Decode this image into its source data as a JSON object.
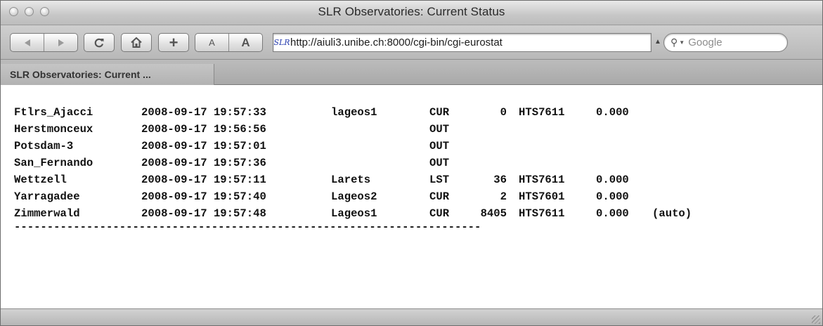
{
  "window": {
    "title": "SLR Observatories: Current Status"
  },
  "toolbar": {
    "back_icon": "back-arrow-icon",
    "forward_icon": "forward-arrow-icon",
    "reload_icon": "reload-icon",
    "home_icon": "home-icon",
    "add_bookmark_label": "+",
    "text_smaller_label": "A",
    "text_bigger_label": "A",
    "address_site_icon_text": "SLR",
    "address_url": "http://aiuli3.unibe.ch:8000/cgi-bin/cgi-eurostat",
    "search_placeholder": "Google"
  },
  "tabs": [
    {
      "label": "SLR Observatories: Current ..."
    }
  ],
  "status_rows": [
    {
      "station": "Ftlrs_Ajacci",
      "date": "2008-09-17",
      "time": "19:57:33",
      "satellite": "lageos1",
      "state": "CUR",
      "count": "0",
      "program": "HTS7611",
      "value": "0.000",
      "mode": ""
    },
    {
      "station": "Herstmonceux",
      "date": "2008-09-17",
      "time": "19:56:56",
      "satellite": "",
      "state": "OUT",
      "count": "",
      "program": "",
      "value": "",
      "mode": ""
    },
    {
      "station": "Potsdam-3",
      "date": "2008-09-17",
      "time": "19:57:01",
      "satellite": "",
      "state": "OUT",
      "count": "",
      "program": "",
      "value": "",
      "mode": ""
    },
    {
      "station": "San_Fernando",
      "date": "2008-09-17",
      "time": "19:57:36",
      "satellite": "",
      "state": "OUT",
      "count": "",
      "program": "",
      "value": "",
      "mode": ""
    },
    {
      "station": "Wettzell",
      "date": "2008-09-17",
      "time": "19:57:11",
      "satellite": "Larets",
      "state": "LST",
      "count": "36",
      "program": "HTS7611",
      "value": "0.000",
      "mode": ""
    },
    {
      "station": "Yarragadee",
      "date": "2008-09-17",
      "time": "19:57:40",
      "satellite": "Lageos2",
      "state": "CUR",
      "count": "2",
      "program": "HTS7601",
      "value": "0.000",
      "mode": ""
    },
    {
      "station": "Zimmerwald",
      "date": "2008-09-17",
      "time": "19:57:48",
      "satellite": "Lageos1",
      "state": "CUR",
      "count": "8405",
      "program": "HTS7611",
      "value": "0.000",
      "mode": "(auto)"
    }
  ],
  "separator_line": "-----------------------------------------------------------------------"
}
